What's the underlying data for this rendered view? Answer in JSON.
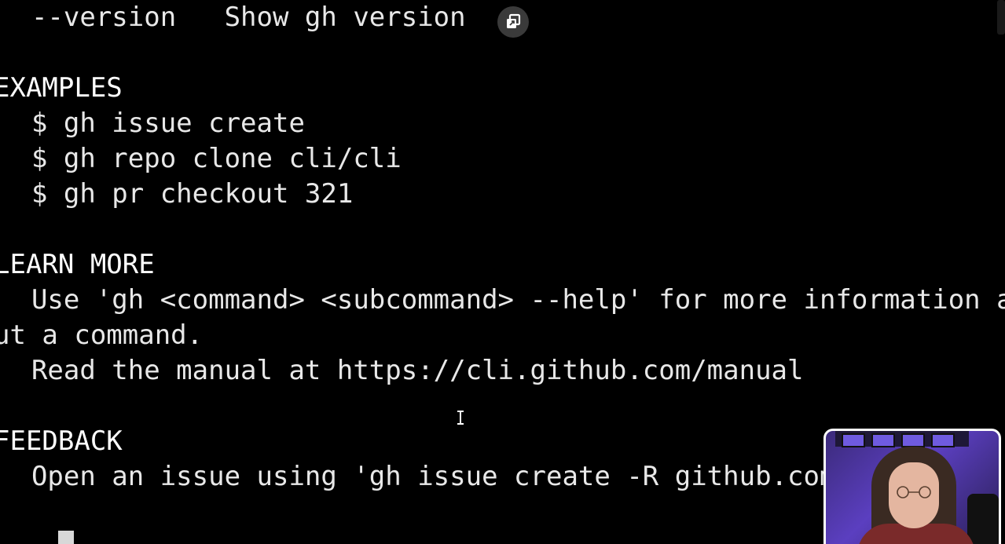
{
  "terminal": {
    "lines": {
      "version_option": "  --version   Show gh version",
      "examples_heading": "EXAMPLES",
      "example_1": "  $ gh issue create",
      "example_2": "  $ gh repo clone cli/cli",
      "example_3": "  $ gh pr checkout 321",
      "learn_more_heading": "LEARN MORE",
      "learn_more_1": "  Use 'gh <command> <subcommand> --help' for more information ab",
      "learn_more_1_wrap": "ut a command.",
      "learn_more_2": "  Read the manual at https://cli.github.com/manual",
      "feedback_heading": "FEEDBACK",
      "feedback_1": "  Open an issue using 'gh issue create -R github.com/cli/cli'"
    },
    "copy_button_icon": "copy-icon",
    "text_color": "#e8e8e8",
    "background_color": "#000000"
  },
  "webcam": {
    "accent_color": "#5b3fc0"
  }
}
